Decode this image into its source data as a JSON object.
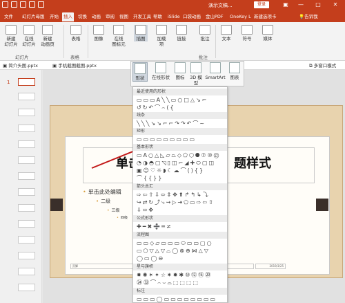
{
  "window": {
    "title": "演示文稿...",
    "login_label": "登录",
    "controls": [
      "—",
      "□",
      "✕"
    ]
  },
  "tabs": [
    {
      "label": "文件",
      "active": false
    },
    {
      "label": "幻灯片母版",
      "active": false
    },
    {
      "label": "开始",
      "active": false
    },
    {
      "label": "插入",
      "active": true
    },
    {
      "label": "切换",
      "active": false
    },
    {
      "label": "动画",
      "active": false
    },
    {
      "label": "审阅",
      "active": false
    },
    {
      "label": "视图",
      "active": false
    },
    {
      "label": "开发工具",
      "active": false
    },
    {
      "label": "帮助",
      "active": false
    },
    {
      "label": "iSlide",
      "active": false
    },
    {
      "label": "口袋动画",
      "active": false
    },
    {
      "label": "金山PDF",
      "active": false
    },
    {
      "label": "OneKey L",
      "active": false
    },
    {
      "label": "新建选项卡",
      "active": false
    }
  ],
  "tell_me": "告诉我",
  "ribbon": {
    "buttons": [
      {
        "label": "新建\n幻灯片",
        "icon": "new-slide-icon"
      },
      {
        "label": "在线\n幻灯片",
        "icon": "online-slide-icon"
      },
      {
        "label": "新建\n动画页",
        "icon": "new-animation-page-icon"
      },
      {
        "label": "表格",
        "icon": "table-icon"
      },
      {
        "label": "图像",
        "icon": "image-icon"
      },
      {
        "label": "在线\n图标元",
        "icon": "online-icon-icon"
      },
      {
        "label": "插图",
        "icon": "illustration-icon"
      },
      {
        "label": "加载\n项",
        "icon": "addin-icon"
      },
      {
        "label": "链接",
        "icon": "link-icon"
      },
      {
        "label": "批注",
        "icon": "comment-icon"
      },
      {
        "label": "文本",
        "icon": "text-icon"
      },
      {
        "label": "符号",
        "icon": "symbol-icon"
      },
      {
        "label": "媒体",
        "icon": "media-icon"
      }
    ],
    "groups": [
      "幻灯片",
      "表格",
      "批注"
    ]
  },
  "doc_tabs": [
    "简介头图.pptx",
    "手机截图截图.pptx"
  ],
  "view_mode": "多窗口模式",
  "thumbnail_number": "1",
  "illustration_dropdown": {
    "buttons": [
      {
        "label": "形状",
        "icon": "shapes-icon",
        "active": true
      },
      {
        "label": "在线形状",
        "icon": "online-shapes-icon",
        "active": false
      },
      {
        "label": "图标",
        "icon": "icons-icon",
        "active": false
      },
      {
        "label": "3D 模型",
        "icon": "3d-model-icon",
        "active": false
      },
      {
        "label": "SmartArt",
        "icon": "smartart-icon",
        "active": false
      },
      {
        "label": "图表",
        "icon": "chart-icon",
        "active": false
      }
    ]
  },
  "gallery": {
    "sections": [
      {
        "title": "最近使用的形状",
        "rows": [
          "▭▭▭A╲╲▭○□△↘⌐",
          "↺↻↶⌒⌢({"
        ]
      },
      {
        "title": "线条",
        "rows": [
          "╲╲╲↘↘⌐⌐↷↷↶⌒~"
        ]
      },
      {
        "title": "矩形",
        "rows": [
          "▭▭▭▭▭▭▭▭▭"
        ]
      },
      {
        "title": "基本形状",
        "rows": [
          "▭A○△◺▱⏢◇⬠⬡⯃⑦⑩⑫",
          "◔◑◓▢◹▯◫⌐◢✚⬭▢◫",
          "▣☺♡☼◗☾☁⌒(){}",
          "⌒{{}}"
        ]
      },
      {
        "title": "箭头总汇",
        "rows": [
          "⇨⇦⇧⇩⬄⇕✥⬆↱↰↳⤵",
          "↪⇄↻⤴⤷⇝▷⇥⬠▭⇨⇦⇧",
          "⇩⬄✥"
        ]
      },
      {
        "title": "公式形状",
        "rows": [
          "✚━✖➗═≠"
        ]
      },
      {
        "title": "流程图",
        "rows": [
          "▭▭◇▱▭▭▭⬭▭▭▢○",
          "▭⬠▽△▽⌓◯⊗⊕⋈△▽",
          "◯▭◯⊖"
        ]
      },
      {
        "title": "星与旗帜",
        "rows": [
          "✸✺✶✦☆✷✹✱⑩⑫⑯⑳",
          "㉔㉜⌒⌢⌣⌓⬚⬚⬚⬚"
        ]
      },
      {
        "title": "标注",
        "rows": [
          "▭▭▭◯▭▭▭▭▭▭▭▭"
        ]
      }
    ]
  },
  "slide": {
    "title_left": "单击",
    "title_right": "题样式",
    "bullets": [
      {
        "text": "单击此处编辑",
        "level": 1
      },
      {
        "text": "二级",
        "level": 2
      },
      {
        "text": "三级",
        "level": 3
      },
      {
        "text": "四级",
        "level": 4
      }
    ],
    "footer_label": "页脚",
    "date_label": "2019/3/25"
  }
}
